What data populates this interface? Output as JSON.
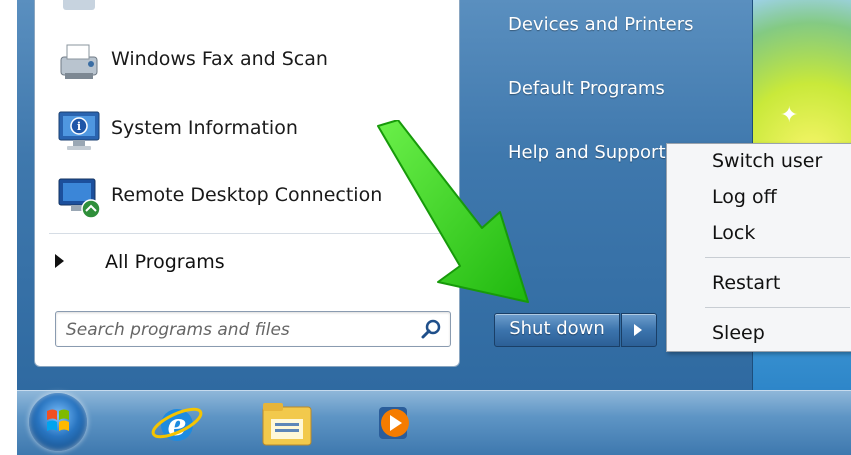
{
  "programs": [
    {
      "label": "Windows Fax and Scan",
      "icon": "fax-scanner-icon"
    },
    {
      "label": "System Information",
      "icon": "system-information-icon"
    },
    {
      "label": "Remote Desktop Connection",
      "icon": "remote-desktop-icon"
    }
  ],
  "all_programs": {
    "label": "All Programs"
  },
  "search": {
    "placeholder": "Search programs and files",
    "value": ""
  },
  "right_links": [
    {
      "label": "Devices and Printers"
    },
    {
      "label": "Default Programs"
    },
    {
      "label": "Help and Support"
    }
  ],
  "shutdown": {
    "label": "Shut down"
  },
  "power_menu": {
    "items": [
      {
        "label": "Switch user"
      },
      {
        "label": "Log off"
      },
      {
        "label": "Lock"
      },
      {
        "label": "Restart"
      },
      {
        "label": "Sleep"
      }
    ]
  },
  "taskbar": {
    "items": [
      {
        "icon": "start-orb-icon"
      },
      {
        "icon": "internet-explorer-icon"
      },
      {
        "icon": "file-explorer-icon"
      },
      {
        "icon": "media-player-icon"
      }
    ]
  },
  "colors": {
    "start_menu_blue": "#3f78ad",
    "annotation_arrow": "#33d11f",
    "taskbar": "#5e95c5"
  }
}
